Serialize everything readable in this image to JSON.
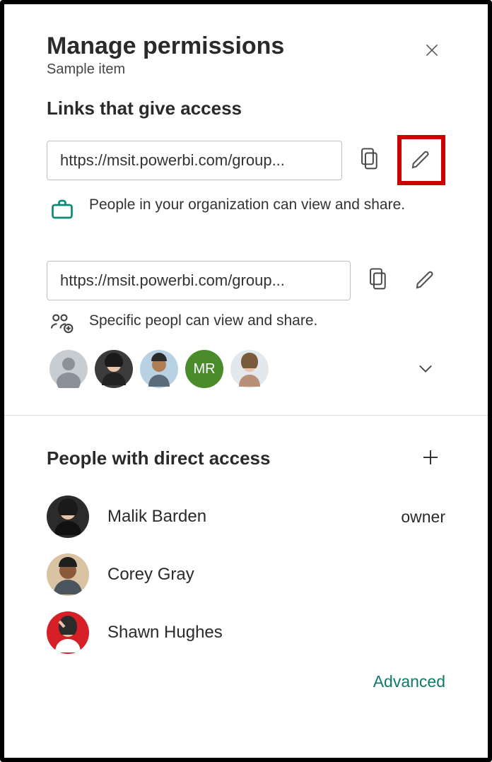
{
  "header": {
    "title": "Manage permissions",
    "subtitle": "Sample item"
  },
  "links_section": {
    "heading": "Links that give access",
    "items": [
      {
        "url": "https://msit.powerbi.com/group...",
        "description": "People in your organization can view and share.",
        "icon": "briefcase",
        "edit_highlighted": true
      },
      {
        "url": "https://msit.powerbi.com/group...",
        "description": "Specific peopl can view and share.",
        "icon": "people-add",
        "edit_highlighted": false,
        "shared_with": [
          {
            "type": "img",
            "bg": "#c8cdd2"
          },
          {
            "type": "img",
            "bg": "#3b3b3b"
          },
          {
            "type": "img",
            "bg": "#b9d2e3"
          },
          {
            "type": "initials",
            "text": "MR",
            "bg": "#4a8b2c"
          },
          {
            "type": "img",
            "bg": "#e3e8ec"
          }
        ]
      }
    ]
  },
  "direct_section": {
    "heading": "People with direct access",
    "people": [
      {
        "name": "Malik Barden",
        "role": "owner",
        "bg": "#2b2b2b"
      },
      {
        "name": "Corey Gray",
        "role": "",
        "bg": "#d9c3a3"
      },
      {
        "name": "Shawn Hughes",
        "role": "",
        "bg": "#d61f26"
      }
    ]
  },
  "footer": {
    "advanced_label": "Advanced"
  }
}
